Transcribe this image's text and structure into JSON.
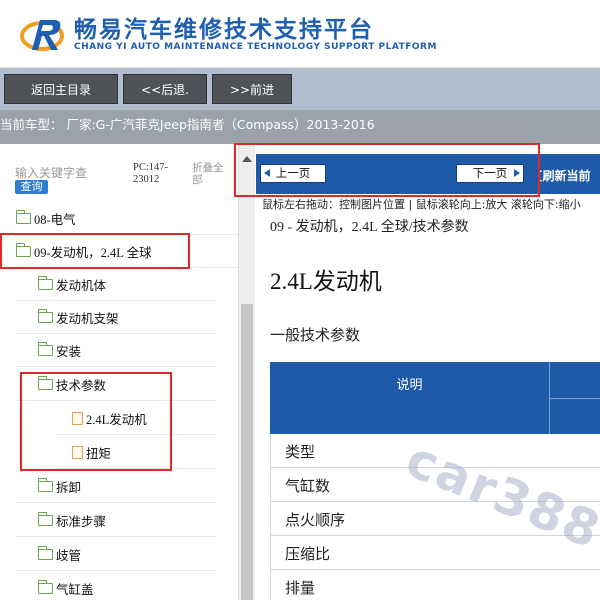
{
  "header": {
    "title_cn": "畅易汽车维修技术支持平台",
    "title_en": "CHANG YI AUTO MAINTENANCE TECHNOLOGY SUPPORT PLATFORM"
  },
  "toolbar": {
    "back_main_label": "返回主目录",
    "prev_step_label": "<<后退.",
    "next_step_label": ">>前进"
  },
  "model_bar": {
    "text": "当前车型：  厂家:G-广汽菲克Jeep指南者（Compass）2013-2016"
  },
  "sidebar": {
    "search_placeholder": "输入关键字查",
    "search_button": "查询",
    "pc_code": "PC:147-23012",
    "collapse_all": "折叠全部",
    "items": [
      {
        "label": "08-电气",
        "icon": "folder-icon"
      },
      {
        "label": "09-发动机，2.4L 全球",
        "icon": "folder-icon"
      },
      {
        "label": "发动机体",
        "icon": "folder-icon"
      },
      {
        "label": "发动机支架",
        "icon": "folder-icon"
      },
      {
        "label": "安装",
        "icon": "folder-icon"
      },
      {
        "label": "技术参数",
        "icon": "folder-icon"
      },
      {
        "label": "2.4L发动机",
        "icon": "file-icon"
      },
      {
        "label": "扭矩",
        "icon": "file-icon"
      },
      {
        "label": "拆卸",
        "icon": "folder-icon"
      },
      {
        "label": "标准步骤",
        "icon": "folder-icon"
      },
      {
        "label": "歧管",
        "icon": "folder-icon"
      },
      {
        "label": "气缸盖",
        "icon": "folder-icon"
      }
    ]
  },
  "content": {
    "prev_page": "上一页",
    "next_page": "下一页",
    "refresh_label": "[刷新当前",
    "hint": "鼠标左右拖动：控制图片位置 | 鼠标滚轮向上:放大 滚轮向下:缩小",
    "breadcrumb": "09 - 发动机，2.4L 全球/技术参数",
    "doc_title": "2.4L发动机",
    "section_heading": "一般技术参数",
    "table": {
      "header_desc": "说明",
      "rows": [
        "类型",
        "气缸数",
        "点火顺序",
        "压缩比",
        "排量"
      ]
    },
    "watermark": "car388"
  },
  "colors": {
    "brand_blue": "#1f5fb0",
    "nav_blue": "#1e5aa8",
    "highlight_red": "#e02828",
    "toolbar_bg": "#b2bdcf",
    "model_bar_bg": "#9aa2aa"
  }
}
